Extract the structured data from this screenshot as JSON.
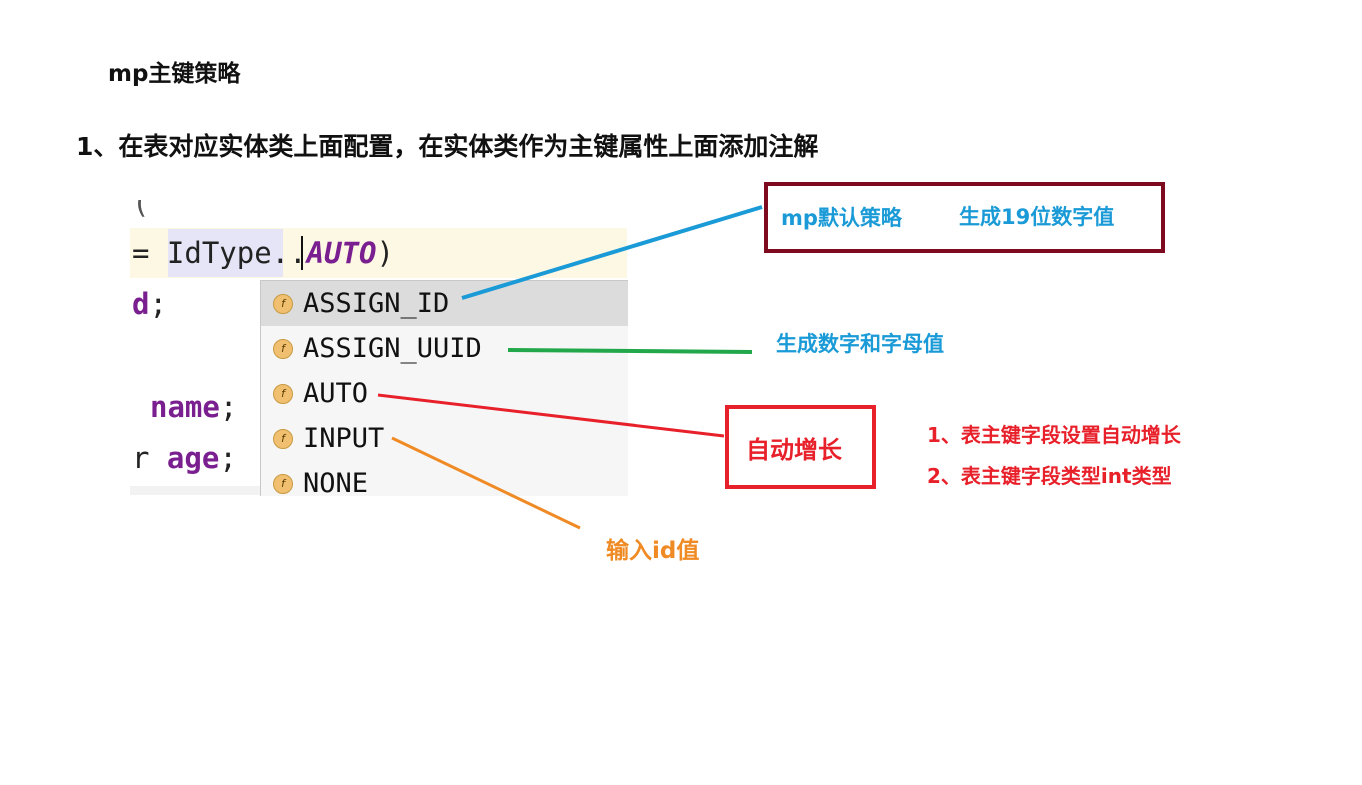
{
  "title": "mp主键策略",
  "heading": "1、在表对应实体类上面配置，在实体类作为主键属性上面添加注解",
  "code": {
    "line0": "(",
    "line1_eq": "= IdType.",
    "line1_dot": ".",
    "line1_auto": "AUTO",
    "line1_close": ")",
    "line2_kw": "d",
    "line2_end": ";",
    "line3_kw": "name",
    "line3_end": ";",
    "line4_prefix": "r ",
    "line4_kw": "age",
    "line4_end": ";"
  },
  "completion": {
    "icon_letter": "f",
    "items": [
      {
        "label": "ASSIGN_ID",
        "selected": true
      },
      {
        "label": "ASSIGN_UUID",
        "selected": false
      },
      {
        "label": "AUTO",
        "selected": false
      },
      {
        "label": "INPUT",
        "selected": false
      },
      {
        "label": "NONE",
        "selected": false
      }
    ]
  },
  "annotations": {
    "default_strategy": "mp默认策略",
    "gen19": "生成19位数字值",
    "uuid_note": "生成数字和字母值",
    "auto_label": "自动增长",
    "auto_note1": "1、表主键字段设置自动增长",
    "auto_note2": "2、表主键字段类型int类型",
    "input_note": "输入id值"
  },
  "colors": {
    "blue": "#1a9ad6",
    "green": "#22a84a",
    "red": "#e8202a",
    "orange": "#f08a24",
    "darkred": "#7d0a1e"
  }
}
